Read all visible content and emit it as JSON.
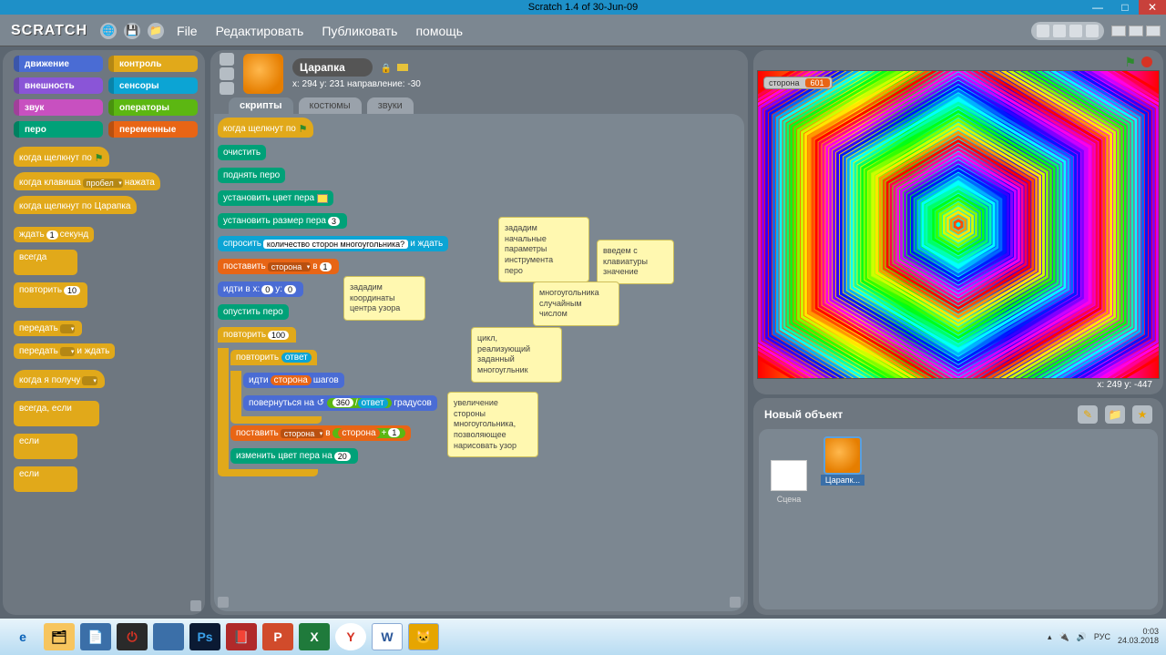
{
  "titlebar": {
    "title": "Scratch 1.4 of 30-Jun-09"
  },
  "menu": {
    "file": "File",
    "edit": "Редактировать",
    "share": "Публиковать",
    "help": "помощь"
  },
  "categories": {
    "motion": "движение",
    "control": "контроль",
    "looks": "внешность",
    "sensing": "сенсоры",
    "sound": "звук",
    "operators": "операторы",
    "pen": "перо",
    "variables": "переменные"
  },
  "palette_blocks": {
    "when_flag": "когда щелкнут по",
    "when_key": "когда клавиша",
    "when_key_arg": "пробел",
    "when_key_tail": "нажата",
    "when_sprite": "когда щелкнут по  Царапка",
    "wait": "ждать",
    "wait_n": "1",
    "wait_tail": "секунд",
    "forever": "всегда",
    "repeat": "повторить",
    "repeat_n": "10",
    "broadcast": "передать",
    "broadcast_wait": "передать",
    "broadcast_wait_tail": "и ждать",
    "when_receive": "когда я получу",
    "forever_if": "всегда, если",
    "if": "если",
    "if2": "если"
  },
  "sprite": {
    "name": "Царапка",
    "coords": "x: 294  y: 231  направление: -30"
  },
  "tabs": {
    "scripts": "скрипты",
    "costumes": "костюмы",
    "sounds": "звуки"
  },
  "script": {
    "hat": "когда щелкнут по",
    "clear": "очистить",
    "penup": "поднять перо",
    "setcolor": "установить цвет пера",
    "setsize": "установить размер пера",
    "setsize_n": "3",
    "ask": "спросить",
    "ask_q": "количество сторон многоугольника?",
    "ask_tail": "и ждать",
    "setvar": "поставить",
    "setvar_var": "сторона",
    "setvar_at": "в",
    "setvar_n": "1",
    "goto": "идти в x:",
    "goto_x": "0",
    "goto_mid": "y:",
    "goto_y": "0",
    "pendown": "опустить перо",
    "repeat1": "повторить",
    "repeat1_n": "100",
    "repeat2": "повторить",
    "repeat2_arg": "ответ",
    "move": "идти",
    "move_var": "сторона",
    "move_tail": "шагов",
    "turn": "повернуться на",
    "turn_div_a": "360",
    "turn_div_op": "/",
    "turn_div_b": "ответ",
    "turn_tail": "градусов",
    "setvar2": "поставить",
    "setvar2_var": "сторона",
    "setvar2_at": "в",
    "setvar2_plus_a": "сторона",
    "setvar2_plus_op": "+",
    "setvar2_plus_b": "1",
    "changecolor": "изменить цвет пера на",
    "changecolor_n": "20"
  },
  "comments": {
    "c1": "зададим\nначальные\nпараметры\nинструмента\nперо",
    "c2": "введем с\nклавиатуры\nзначение",
    "c3": "многоугольника\nслучайным\nчислом",
    "c4": "зададим\nкоординаты\nцентра узора",
    "c5": "цикл,\nреализующий\nзаданный\nмногоугльник",
    "c6": "увеличение\nстороны\nмногоугольника,\nпозволяющее\nнарисовать узор"
  },
  "stage": {
    "var_name": "сторона",
    "var_value": "601",
    "mouse": "x: 249   y: -447"
  },
  "sprites_panel": {
    "title": "Новый объект",
    "stage_label": "Сцена",
    "item1": "Царапк..."
  },
  "taskbar": {
    "lang": "РУС",
    "time": "0:03",
    "date": "24.03.2018"
  }
}
